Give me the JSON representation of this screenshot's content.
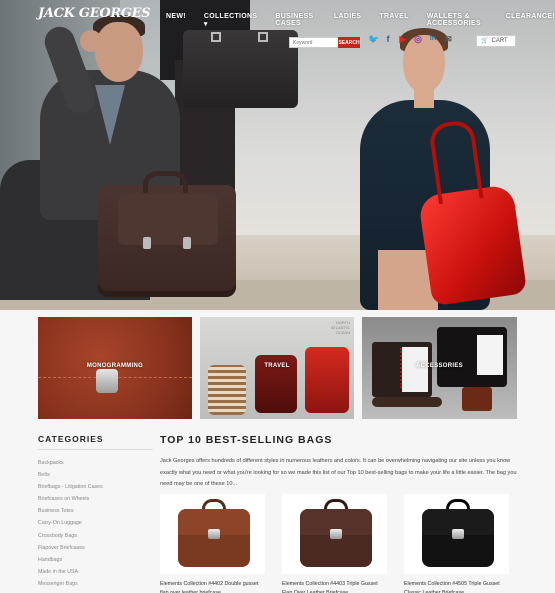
{
  "brand": {
    "logo_text": "JACK GEORGES"
  },
  "nav": {
    "items": [
      {
        "label": "NEW!"
      },
      {
        "label": "COLLECTIONS ▾"
      },
      {
        "label": "BUSINESS CASES"
      },
      {
        "label": "LADIES"
      },
      {
        "label": "TRAVEL"
      },
      {
        "label": "WALLETS & ACCESSORIES"
      },
      {
        "label": "CLEARANCE!"
      }
    ]
  },
  "search": {
    "placeholder": "Keyword",
    "button_label": "SEARCH"
  },
  "social": {
    "icons": [
      "twitter-icon",
      "facebook-icon",
      "youtube-icon",
      "instagram-icon",
      "linkedin-icon",
      "email-icon"
    ],
    "glyphs": [
      "🐦",
      "f",
      "▶",
      "◎",
      "in",
      "✉"
    ],
    "colors": [
      "#1da1f2",
      "#3b5998",
      "#e62117",
      "#8a3ab9",
      "#0077b5",
      "#555555"
    ]
  },
  "cart": {
    "label": "CART"
  },
  "tiles": [
    {
      "label": "MONOGRAMMING"
    },
    {
      "label": "TRAVEL",
      "map_text": "NORTH\nATLANTIC\nOCEAN"
    },
    {
      "label": "ACCESSORIES"
    }
  ],
  "sidebar": {
    "title": "CATEGORIES",
    "items": [
      "Backpacks",
      "Belts",
      "Briefbags - Litigation Cases",
      "Briefcases on Wheels",
      "Business Totes",
      "Carry-On Luggage",
      "Crossbody Bags",
      "Flapover Briefcases",
      "Handbags",
      "Made in the USA",
      "Messenger Bags"
    ]
  },
  "main": {
    "title": "TOP 10 BEST-SELLING BAGS",
    "intro": "Jack Georges offers hundreds of different styles in numerous leathers and colors. It can be overwhelming navigating our site unless you know exactly what you need or what you're looking for so we made this list of our Top 10 best-selling bags to make your life a little easier. The bag you need may be one of these 10...",
    "products": [
      {
        "name": "Elements Collection #4402 Double gusset flap over leather briefcase",
        "color": "#7a3a22",
        "flap": "#8c4529",
        "handle": "#5a2a17"
      },
      {
        "name": "Elements Collection #4403 Triple Gusset Flap Over Leather Briefcase",
        "color": "#4a2a22",
        "flap": "#56322a",
        "handle": "#2f1a15"
      },
      {
        "name": "Elements Collection #4505 Triple Gusset Classic Leather Briefcase",
        "color": "#121212",
        "flap": "#1b1b1b",
        "handle": "#050505"
      }
    ]
  }
}
